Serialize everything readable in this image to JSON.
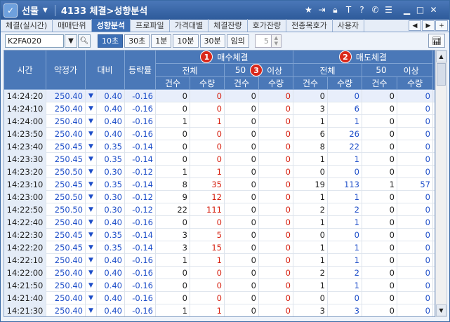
{
  "titlebar": {
    "menu_label": "선물",
    "title": "4133 체결>성향분석",
    "icons": [
      "star-icon",
      "export-icon",
      "lock-icon",
      "text-icon",
      "help-icon",
      "phone-icon",
      "list-icon",
      "minimize-icon",
      "maximize-icon",
      "close-icon"
    ]
  },
  "tabs": [
    "체결(실시간)",
    "매매단위",
    "성향분석",
    "프로파일",
    "가격대별",
    "체결잔량",
    "호가잔량",
    "전종목호가",
    "사용자"
  ],
  "active_tab": 2,
  "toolbar": {
    "code": "K2FA020",
    "intervals": [
      "10초",
      "30초",
      "1분",
      "10분",
      "30분",
      "임의"
    ],
    "active_interval": 0,
    "count_value": "5"
  },
  "header": {
    "time": "시간",
    "price": "약정가",
    "diff": "대비",
    "rate": "등락률",
    "buy_group": "매수체결",
    "sell_group": "매도체결",
    "badge1": "1",
    "badge2": "2",
    "badge3": "3",
    "total": "전체",
    "fifty": "50",
    "above": "이상",
    "count": "건수",
    "qty": "수량"
  },
  "rows": [
    {
      "t": "14:24:20",
      "p": "250.40",
      "d": "0.40",
      "r": "-0.16",
      "bc": "0",
      "bq": "0",
      "b50c": "0",
      "b50q": "0",
      "sc": "0",
      "sq": "0",
      "s50c": "0",
      "s50q": "0"
    },
    {
      "t": "14:24:10",
      "p": "250.40",
      "d": "0.40",
      "r": "-0.16",
      "bc": "0",
      "bq": "0",
      "b50c": "0",
      "b50q": "0",
      "sc": "3",
      "sq": "6",
      "s50c": "0",
      "s50q": "0"
    },
    {
      "t": "14:24:00",
      "p": "250.40",
      "d": "0.40",
      "r": "-0.16",
      "bc": "1",
      "bq": "1",
      "b50c": "0",
      "b50q": "0",
      "sc": "1",
      "sq": "1",
      "s50c": "0",
      "s50q": "0"
    },
    {
      "t": "14:23:50",
      "p": "250.40",
      "d": "0.40",
      "r": "-0.16",
      "bc": "0",
      "bq": "0",
      "b50c": "0",
      "b50q": "0",
      "sc": "6",
      "sq": "26",
      "s50c": "0",
      "s50q": "0"
    },
    {
      "t": "14:23:40",
      "p": "250.45",
      "d": "0.35",
      "r": "-0.14",
      "bc": "0",
      "bq": "0",
      "b50c": "0",
      "b50q": "0",
      "sc": "8",
      "sq": "22",
      "s50c": "0",
      "s50q": "0"
    },
    {
      "t": "14:23:30",
      "p": "250.45",
      "d": "0.35",
      "r": "-0.14",
      "bc": "0",
      "bq": "0",
      "b50c": "0",
      "b50q": "0",
      "sc": "1",
      "sq": "1",
      "s50c": "0",
      "s50q": "0"
    },
    {
      "t": "14:23:20",
      "p": "250.50",
      "d": "0.30",
      "r": "-0.12",
      "bc": "1",
      "bq": "1",
      "b50c": "0",
      "b50q": "0",
      "sc": "0",
      "sq": "0",
      "s50c": "0",
      "s50q": "0"
    },
    {
      "t": "14:23:10",
      "p": "250.45",
      "d": "0.35",
      "r": "-0.14",
      "bc": "8",
      "bq": "35",
      "b50c": "0",
      "b50q": "0",
      "sc": "19",
      "sq": "113",
      "s50c": "1",
      "s50q": "57"
    },
    {
      "t": "14:23:00",
      "p": "250.50",
      "d": "0.30",
      "r": "-0.12",
      "bc": "9",
      "bq": "12",
      "b50c": "0",
      "b50q": "0",
      "sc": "1",
      "sq": "1",
      "s50c": "0",
      "s50q": "0"
    },
    {
      "t": "14:22:50",
      "p": "250.50",
      "d": "0.30",
      "r": "-0.12",
      "bc": "22",
      "bq": "111",
      "b50c": "0",
      "b50q": "0",
      "sc": "2",
      "sq": "2",
      "s50c": "0",
      "s50q": "0"
    },
    {
      "t": "14:22:40",
      "p": "250.40",
      "d": "0.40",
      "r": "-0.16",
      "bc": "0",
      "bq": "0",
      "b50c": "0",
      "b50q": "0",
      "sc": "1",
      "sq": "1",
      "s50c": "0",
      "s50q": "0"
    },
    {
      "t": "14:22:30",
      "p": "250.45",
      "d": "0.35",
      "r": "-0.14",
      "bc": "3",
      "bq": "5",
      "b50c": "0",
      "b50q": "0",
      "sc": "0",
      "sq": "0",
      "s50c": "0",
      "s50q": "0"
    },
    {
      "t": "14:22:20",
      "p": "250.45",
      "d": "0.35",
      "r": "-0.14",
      "bc": "3",
      "bq": "15",
      "b50c": "0",
      "b50q": "0",
      "sc": "1",
      "sq": "1",
      "s50c": "0",
      "s50q": "0"
    },
    {
      "t": "14:22:10",
      "p": "250.40",
      "d": "0.40",
      "r": "-0.16",
      "bc": "1",
      "bq": "1",
      "b50c": "0",
      "b50q": "0",
      "sc": "1",
      "sq": "1",
      "s50c": "0",
      "s50q": "0"
    },
    {
      "t": "14:22:00",
      "p": "250.40",
      "d": "0.40",
      "r": "-0.16",
      "bc": "0",
      "bq": "0",
      "b50c": "0",
      "b50q": "0",
      "sc": "2",
      "sq": "2",
      "s50c": "0",
      "s50q": "0"
    },
    {
      "t": "14:21:50",
      "p": "250.40",
      "d": "0.40",
      "r": "-0.16",
      "bc": "0",
      "bq": "0",
      "b50c": "0",
      "b50q": "0",
      "sc": "1",
      "sq": "1",
      "s50c": "0",
      "s50q": "0"
    },
    {
      "t": "14:21:40",
      "p": "250.40",
      "d": "0.40",
      "r": "-0.16",
      "bc": "0",
      "bq": "0",
      "b50c": "0",
      "b50q": "0",
      "sc": "0",
      "sq": "0",
      "s50c": "0",
      "s50q": "0"
    },
    {
      "t": "14:21:30",
      "p": "250.40",
      "d": "0.40",
      "r": "-0.16",
      "bc": "1",
      "bq": "1",
      "b50c": "0",
      "b50q": "0",
      "sc": "3",
      "sq": "3",
      "s50c": "0",
      "s50q": "0"
    }
  ],
  "colors": {
    "header_bg": "#4a78b8",
    "buy": "#d62010",
    "sell": "#1f4fc9",
    "badge": "#d9281b"
  }
}
